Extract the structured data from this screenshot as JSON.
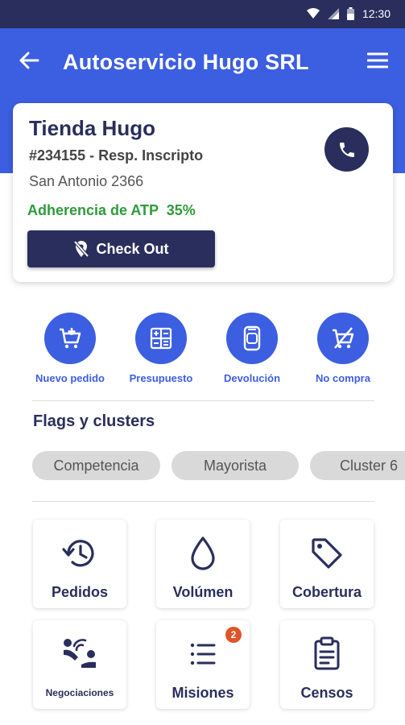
{
  "status_bar": {
    "time": "12:30",
    "icons": [
      "wifi-icon",
      "signal-icon",
      "battery-icon"
    ]
  },
  "header": {
    "title": "Autoservicio Hugo SRL",
    "back_icon": "arrow-left-icon",
    "menu_icon": "hamburger-menu-icon"
  },
  "store": {
    "name": "Tienda Hugo",
    "id_line": "#234155 - Resp. Inscripto",
    "address": "San Antonio 2366",
    "adherence": "Adherencia de ATP  35%",
    "call_icon": "phone-icon",
    "checkout_label": "Check Out",
    "checkout_icon": "location-off-icon"
  },
  "actions": [
    {
      "label": "Nuevo pedido",
      "icon": "cart-add-icon"
    },
    {
      "label": "Presupuesto",
      "icon": "calculator-icon"
    },
    {
      "label": "Devolución",
      "icon": "can-icon"
    },
    {
      "label": "No compra",
      "icon": "cart-off-icon"
    }
  ],
  "flags": {
    "title": "Flags y clusters",
    "chips": [
      "Competencia",
      "Mayorista",
      "Cluster 6"
    ]
  },
  "tiles": [
    {
      "label": "Pedidos",
      "icon": "history-icon"
    },
    {
      "label": "Volúmen",
      "icon": "drop-icon"
    },
    {
      "label": "Cobertura",
      "icon": "tag-icon"
    },
    {
      "label": "Negociaciones",
      "icon": "handshake-icon"
    },
    {
      "label": "Misiones",
      "icon": "list-icon",
      "badge": "2"
    },
    {
      "label": "Censos",
      "icon": "clipboard-icon"
    }
  ],
  "colors": {
    "primary": "#3c5ee0",
    "dark": "#2a2e5c",
    "success": "#2e9b3a",
    "badge": "#e0542a"
  }
}
